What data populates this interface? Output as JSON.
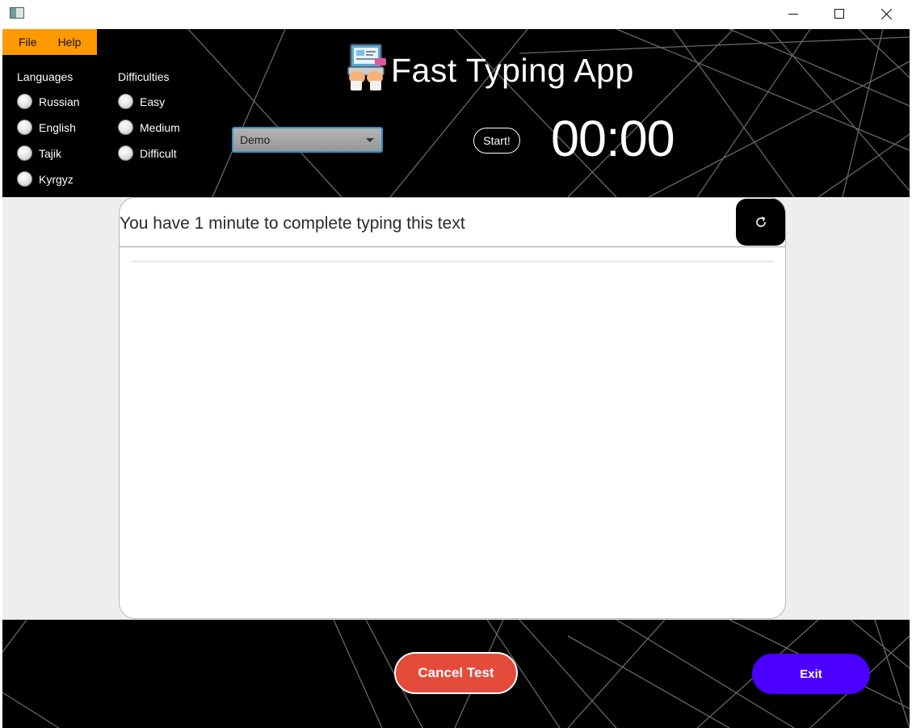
{
  "window": {
    "icons": {
      "app": "app-window-icon",
      "minimize": "minimize-icon",
      "maximize": "maximize-icon",
      "close": "close-icon"
    }
  },
  "menu": {
    "items": [
      "File",
      "Help"
    ],
    "accent": "#ff9900"
  },
  "languages": {
    "title": "Languages",
    "options": [
      "Russian",
      "English",
      "Tajik",
      "Kyrgyz"
    ]
  },
  "difficulties": {
    "title": "Difficulties",
    "options": [
      "Easy",
      "Medium",
      "Difficult"
    ]
  },
  "header": {
    "title": "Fast Typing App",
    "logo_icon": "laptop-typing-icon"
  },
  "mode_select": {
    "selected": "Demo"
  },
  "controls": {
    "start_label": "Start!",
    "timer": "00:00"
  },
  "typing": {
    "prompt": "You have 1 minute to complete typing this text",
    "refresh_icon": "refresh-icon",
    "input_value": ""
  },
  "footer": {
    "cancel_label": "Cancel Test",
    "exit_label": "Exit",
    "cancel_color": "#e44b3b",
    "exit_color": "#4b00ff"
  }
}
